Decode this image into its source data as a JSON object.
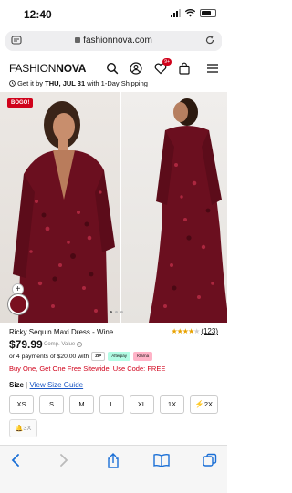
{
  "status": {
    "time": "12:40"
  },
  "browser": {
    "url": "fashionnova.com"
  },
  "header": {
    "logo_light": "FASHION",
    "logo_bold": "NOVA",
    "wishlist_count": "9+"
  },
  "shipping": {
    "prefix": "Get it by ",
    "date": "THU, JUL 31",
    "suffix": " with 1-Day Shipping"
  },
  "gallery": {
    "badge": "BOGO!",
    "add_label": "+",
    "active_dot": 1,
    "dot_count": 3
  },
  "product": {
    "name": "Ricky Sequin Maxi Dress - Wine",
    "rating_stars": 4,
    "rating_count": "(123)",
    "price": "$79.99",
    "comp_value": "Comp. Value",
    "installments": "or 4 payments of $20.00 with",
    "pay_badges": [
      "ZIP",
      "Afterpay",
      "Klarna"
    ],
    "promo": "Buy One, Get One Free Sitewide! Use Code: FREE"
  },
  "size": {
    "label": "Size",
    "separator": " | ",
    "guide": "View Size Guide",
    "options": [
      "XS",
      "S",
      "M",
      "L",
      "XL",
      "1X",
      "2X"
    ],
    "extra": "3X"
  },
  "colors": {
    "accent": "#d0021b",
    "swatch": "#7a1020",
    "link": "#1a56c4",
    "star": "#e8a200"
  }
}
